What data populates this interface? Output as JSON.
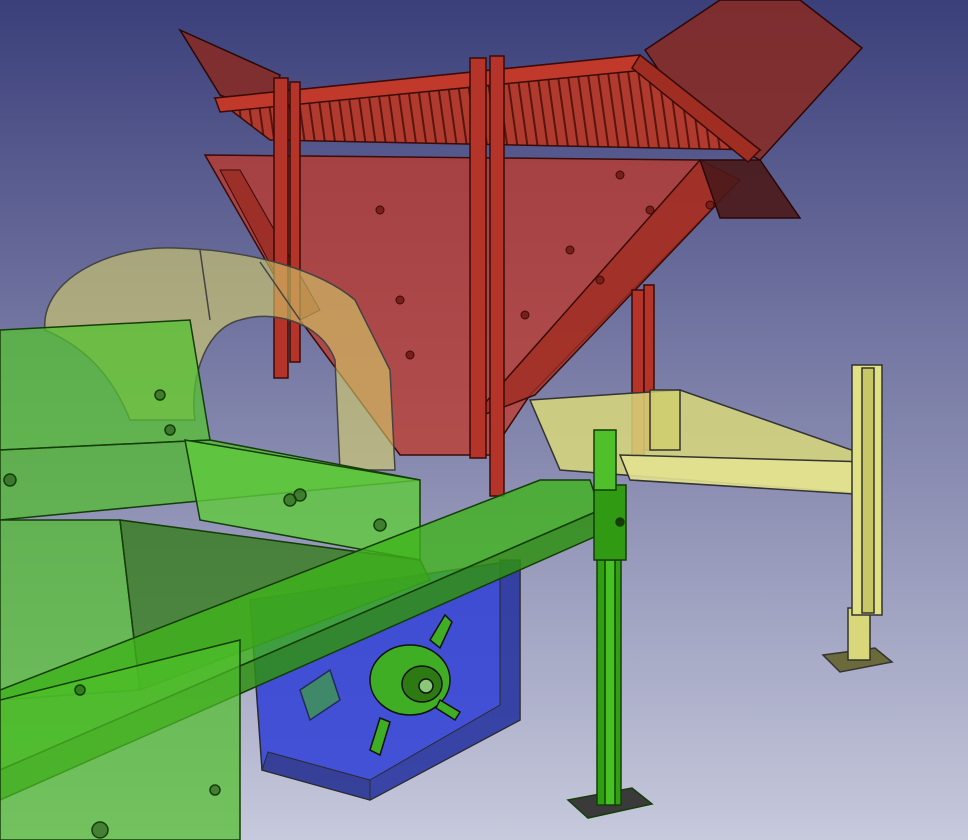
{
  "viewport": {
    "background_top": "#3b3f7a",
    "background_bottom": "#c7c9dc"
  },
  "colors": {
    "hopper_red": "#c0392b",
    "hopper_dark": "#7a1e18",
    "frame_green": "#4fbf2a",
    "frame_green_dark": "#2d7a12",
    "support_yellow": "#d8d87a",
    "guard_yellow": "#d6cf6a",
    "bin_blue": "#2e3fd6",
    "edge": "#1b1b1b"
  },
  "parts": [
    {
      "name": "hopper",
      "color_key": "hopper_red"
    },
    {
      "name": "feed-grate",
      "color_key": "hopper_red"
    },
    {
      "name": "chute-flaps",
      "color_key": "hopper_dark"
    },
    {
      "name": "arch-guard",
      "color_key": "guard_yellow"
    },
    {
      "name": "main-frame",
      "color_key": "frame_green"
    },
    {
      "name": "support-leg-front",
      "color_key": "frame_green"
    },
    {
      "name": "side-beam-right",
      "color_key": "support_yellow"
    },
    {
      "name": "support-leg-right",
      "color_key": "support_yellow"
    },
    {
      "name": "collection-bin",
      "color_key": "bin_blue"
    },
    {
      "name": "rotor-assembly",
      "color_key": "frame_green_dark"
    }
  ]
}
